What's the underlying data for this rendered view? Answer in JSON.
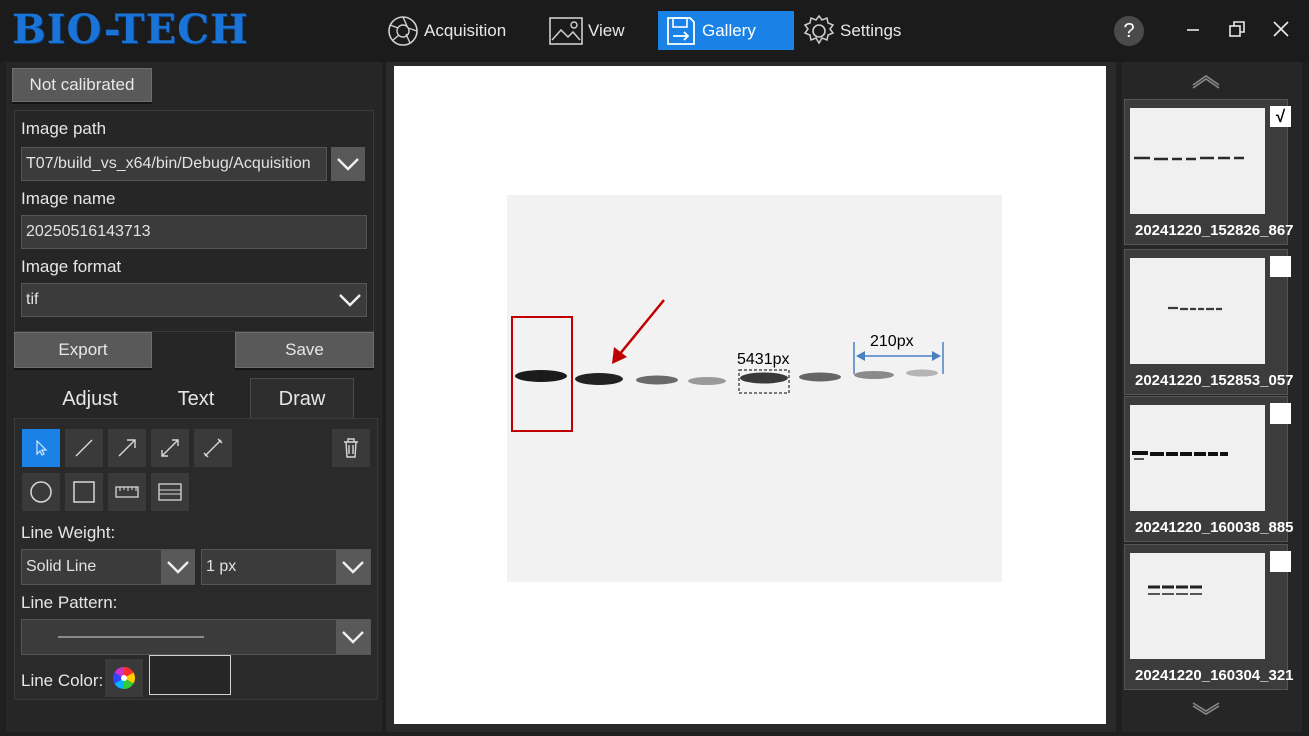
{
  "app": {
    "logo": "BIO-TECH"
  },
  "nav": [
    {
      "label": "Acquisition",
      "icon": "aperture-icon",
      "active": false
    },
    {
      "label": "View",
      "icon": "image-icon",
      "active": false
    },
    {
      "label": "Gallery",
      "icon": "save-icon",
      "active": true
    },
    {
      "label": "Settings",
      "icon": "gear-icon",
      "active": false
    }
  ],
  "window": {
    "help": "?"
  },
  "left": {
    "calibration_button": "Not calibrated",
    "image_path_label": "Image path",
    "image_path_value": "T07/build_vs_x64/bin/Debug/Acquisition",
    "image_name_label": "Image name",
    "image_name_value": "20250516143713",
    "image_format_label": "Image format",
    "image_format_value": "tif",
    "export_button": "Export",
    "save_button": "Save",
    "tabs": [
      "Adjust",
      "Text",
      "Draw"
    ],
    "active_tab": "Draw",
    "line_weight_label": "Line Weight:",
    "line_style_value": "Solid Line",
    "line_weight_value": "1 px",
    "line_pattern_label": "Line Pattern:",
    "line_color_label": "Line Color:"
  },
  "canvas": {
    "annotation_area": "5431px",
    "annotation_distance": "210px",
    "box_color": "#c00000",
    "arrow_color": "#c00000",
    "measure_color": "#4a7fc1"
  },
  "gallery": {
    "items": [
      {
        "name": "20241220_152826_867",
        "checked": true,
        "check_mark": "√"
      },
      {
        "name": "20241220_152853_057",
        "checked": false,
        "check_mark": ""
      },
      {
        "name": "20241220_160038_885",
        "checked": false,
        "check_mark": ""
      },
      {
        "name": "20241220_160304_321",
        "checked": false,
        "check_mark": ""
      }
    ]
  }
}
